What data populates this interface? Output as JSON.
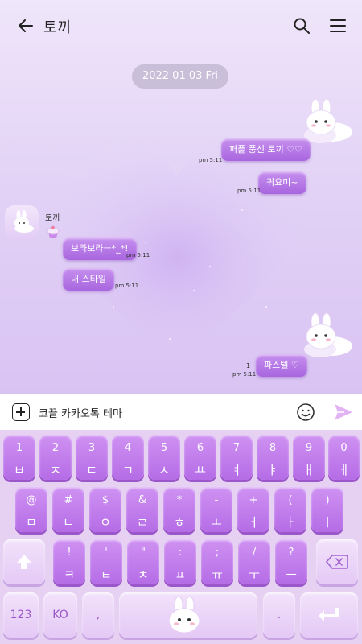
{
  "header": {
    "title": "토끼",
    "back_icon": "arrow-left-icon",
    "search_icon": "search-icon",
    "menu_icon": "hamburger-menu-icon"
  },
  "chat": {
    "date": "2022 01 03 Fri",
    "sent": [
      {
        "text": "퍼플 풍선 토끼 ♡♡",
        "time": "pm 5:11"
      },
      {
        "text": "귀요미~",
        "time": "pm 5:11"
      },
      {
        "text": "파스텔 ♡",
        "time": "pm 5:11",
        "unread": "1"
      }
    ],
    "sender_name": "토끼",
    "received": [
      {
        "text": "보라보라ㅡ*_*!",
        "time": "pm 5:11"
      },
      {
        "text": "내 스타일",
        "time": "pm 5:11"
      }
    ]
  },
  "input": {
    "value": "코끌 카카오톡 테마",
    "plus_icon": "plus-square-icon",
    "emoji_icon": "smile-icon",
    "send_icon": "send-icon"
  },
  "keyboard": {
    "row1": [
      {
        "top": "1",
        "bot": "ㅂ"
      },
      {
        "top": "2",
        "bot": "ㅈ"
      },
      {
        "top": "3",
        "bot": "ㄷ"
      },
      {
        "top": "4",
        "bot": "ㄱ"
      },
      {
        "top": "5",
        "bot": "ㅅ"
      },
      {
        "top": "6",
        "bot": "ㅛ"
      },
      {
        "top": "7",
        "bot": "ㅕ"
      },
      {
        "top": "8",
        "bot": "ㅑ"
      },
      {
        "top": "9",
        "bot": "ㅐ"
      },
      {
        "top": "0",
        "bot": "ㅔ"
      }
    ],
    "row2": [
      {
        "top": "@",
        "bot": "ㅁ"
      },
      {
        "top": "#",
        "bot": "ㄴ"
      },
      {
        "top": "$",
        "bot": "ㅇ"
      },
      {
        "top": "&",
        "bot": "ㄹ"
      },
      {
        "top": "*",
        "bot": "ㅎ"
      },
      {
        "top": "-",
        "bot": "ㅗ"
      },
      {
        "top": "+",
        "bot": "ㅓ"
      },
      {
        "top": "(",
        "bot": "ㅏ"
      },
      {
        "top": ")",
        "bot": "ㅣ"
      }
    ],
    "row3": [
      {
        "top": "!",
        "bot": "ㅋ"
      },
      {
        "top": "'",
        "bot": "ㅌ"
      },
      {
        "top": "\"",
        "bot": "ㅊ"
      },
      {
        "top": ":",
        "bot": "ㅍ"
      },
      {
        "top": ";",
        "bot": "ㅠ"
      },
      {
        "top": "/",
        "bot": "ㅜ"
      },
      {
        "top": "?",
        "bot": "ㅡ"
      }
    ],
    "shift_icon": "shift-arrow-icon",
    "backspace_icon": "backspace-icon",
    "numbers_label": "123",
    "lang_label": "KO",
    "comma_label": ",",
    "period_label": ".",
    "enter_icon": "enter-return-icon"
  },
  "colors": {
    "bubble": "#b776e6",
    "key": "#c07cea",
    "key_light": "#eed9fa",
    "chat_bg": "#e3d3f6"
  }
}
